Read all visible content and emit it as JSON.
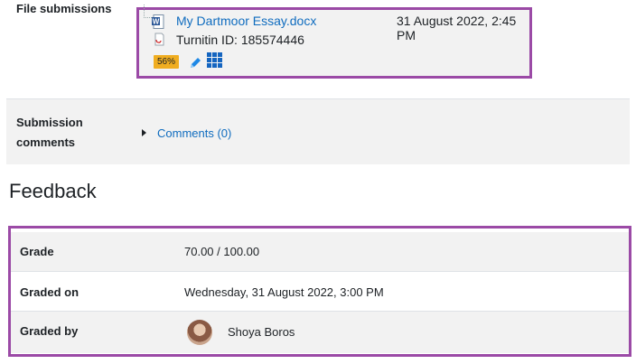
{
  "submission": {
    "file_label": "File submissions",
    "file_name": "My Dartmoor Essay.docx",
    "file_date": "31 August 2022, 2:45 PM",
    "turnitin_id": "Turnitin ID: 185574446",
    "similarity": "56%",
    "comments_label": "Submission comments",
    "comments_label_line1": "Submission",
    "comments_label_line2": "comments",
    "comments_link": "Comments (0)"
  },
  "feedback": {
    "heading": "Feedback",
    "rows": [
      {
        "label": "Grade",
        "value": "70.00 / 100.00"
      },
      {
        "label": "Graded on",
        "value": "Wednesday, 31 August 2022, 3:00 PM"
      },
      {
        "label": "Graded by",
        "value": "Shoya Boros"
      }
    ]
  },
  "colors": {
    "highlight_border": "#9b4aa6",
    "link": "#0f6cbf",
    "badge": "#f0ad20"
  }
}
